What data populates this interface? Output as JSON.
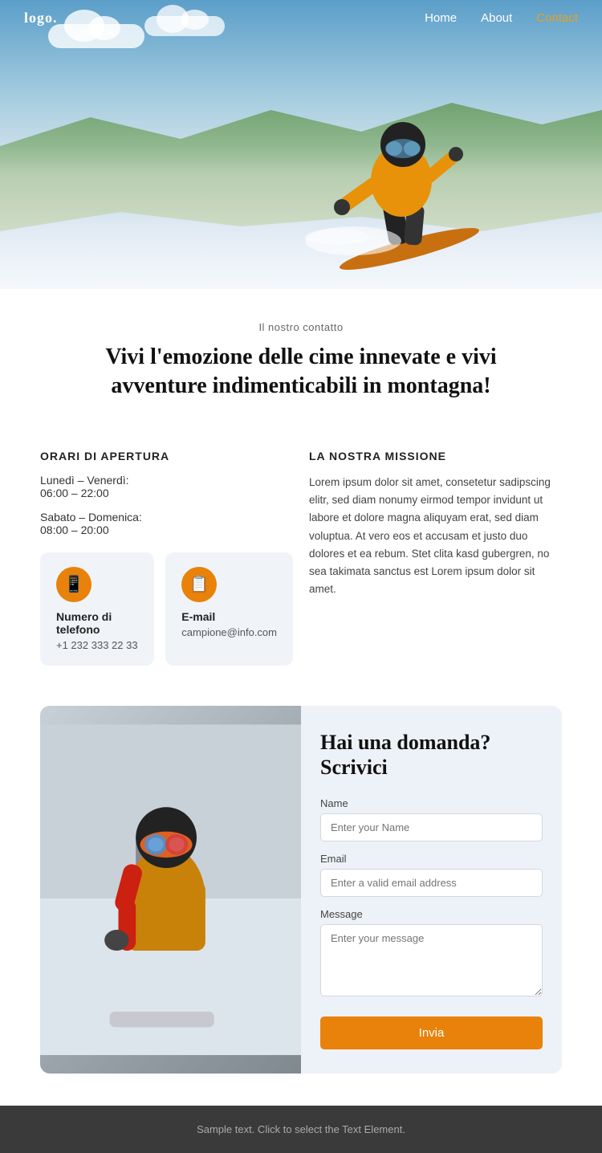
{
  "nav": {
    "logo": "logo.",
    "links": [
      {
        "label": "Home",
        "active": false
      },
      {
        "label": "About",
        "active": false
      },
      {
        "label": "Contact",
        "active": true
      }
    ]
  },
  "contact": {
    "subtitle": "Il nostro contatto",
    "title": "Vivi l'emozione delle cime innevate e vivi avventure indimenticabili in montagna!",
    "hours_heading": "ORARI DI APERTURA",
    "hours": [
      {
        "label": "Lunedì – Venerdì:",
        "time": "06:00 – 22:00"
      },
      {
        "label": "Sabato – Domenica:",
        "time": "08:00 – 20:00"
      }
    ],
    "cards": [
      {
        "icon": "📱",
        "label": "Numero di telefono",
        "value": "+1 232 333 22 33"
      },
      {
        "icon": "📋",
        "label": "E-mail",
        "value": "campione@info.com"
      }
    ],
    "mission_heading": "LA NOSTRA MISSIONE",
    "mission_text": "Lorem ipsum dolor sit amet, consetetur sadipscing elitr, sed diam nonumy eirmod tempor invidunt ut labore et dolore magna aliquyam erat, sed diam voluptua. At vero eos et accusam et justo duo dolores et ea rebum. Stet clita kasd gubergren, no sea takimata sanctus est Lorem ipsum dolor sit amet."
  },
  "form": {
    "title": "Hai una domanda? Scrivici",
    "fields": {
      "name_label": "Name",
      "name_placeholder": "Enter your Name",
      "email_label": "Email",
      "email_placeholder": "Enter a valid email address",
      "message_label": "Message",
      "message_placeholder": "Enter your message"
    },
    "submit_label": "Invia"
  },
  "footer": {
    "text": "Sample text. Click to select the Text Element."
  }
}
